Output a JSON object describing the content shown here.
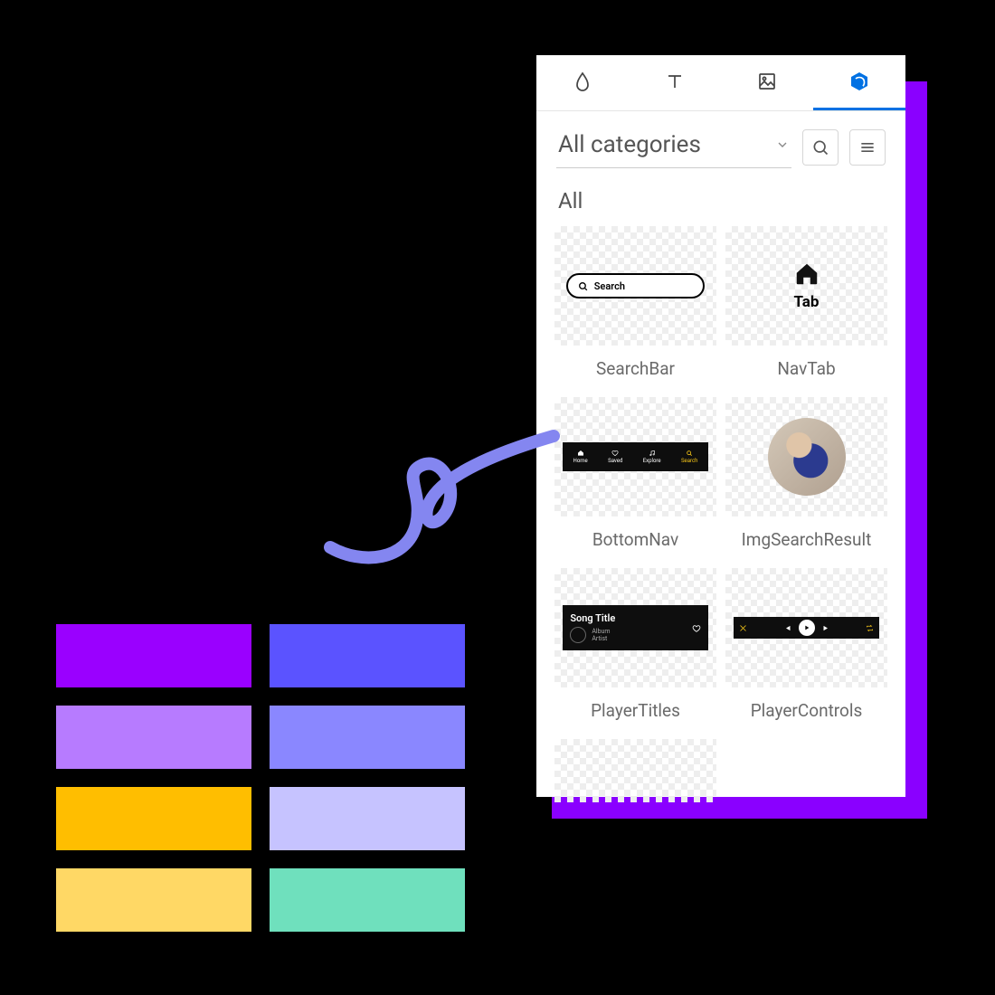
{
  "tabs": {
    "active_index": 3,
    "items": [
      "drop",
      "type",
      "image",
      "components"
    ]
  },
  "filters": {
    "category_label": "All categories"
  },
  "section_title": "All",
  "cards": [
    {
      "label": "SearchBar",
      "preview": {
        "placeholder": "Search"
      }
    },
    {
      "label": "NavTab",
      "preview": {
        "label": "Tab"
      }
    },
    {
      "label": "BottomNav",
      "preview": {
        "items": [
          {
            "label": "Home"
          },
          {
            "label": "Saved"
          },
          {
            "label": "Explore"
          },
          {
            "label": "Search",
            "active": true
          }
        ]
      }
    },
    {
      "label": "ImgSearchResult"
    },
    {
      "label": "PlayerTitles",
      "preview": {
        "title": "Song Title",
        "album": "Album",
        "artist": "Artist"
      }
    },
    {
      "label": "PlayerControls"
    }
  ],
  "palette": [
    "#9a00ff",
    "#5b53ff",
    "#b77bff",
    "#8a87ff",
    "#ffbe00",
    "#c6c3ff",
    "#ffd865",
    "#6fe0bd"
  ],
  "colors": {
    "accent_blue": "#0071e3",
    "panel_shadow": "#8a00ff",
    "squiggle": "#8486f0"
  }
}
